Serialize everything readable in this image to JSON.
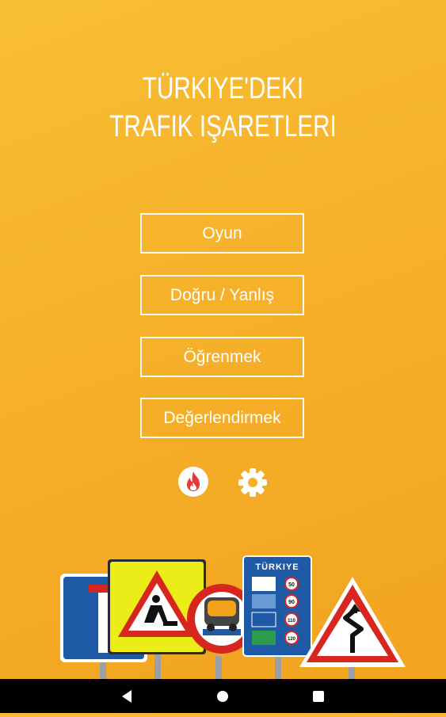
{
  "title": {
    "line1": "TÜRKIYE'DEKI",
    "line2": "TRAFIK IŞARETLERI"
  },
  "menu": {
    "game": "Oyun",
    "true_false": "Doğru / Yanlış",
    "learn": "Öğrenmek",
    "rate": "Değerlendirmek"
  },
  "icons": {
    "flame": "flame-icon",
    "settings": "gear-icon"
  },
  "signs": {
    "turkey_board_label": "TÜRKIYE",
    "speed_limits": [
      "50",
      "90",
      "110",
      "120"
    ]
  },
  "colors": {
    "background": "#f6b02a",
    "flame": "#e53935",
    "sign_blue": "#1f5aa6",
    "sign_yellow": "#ecec19",
    "sign_red": "#d7261e"
  }
}
